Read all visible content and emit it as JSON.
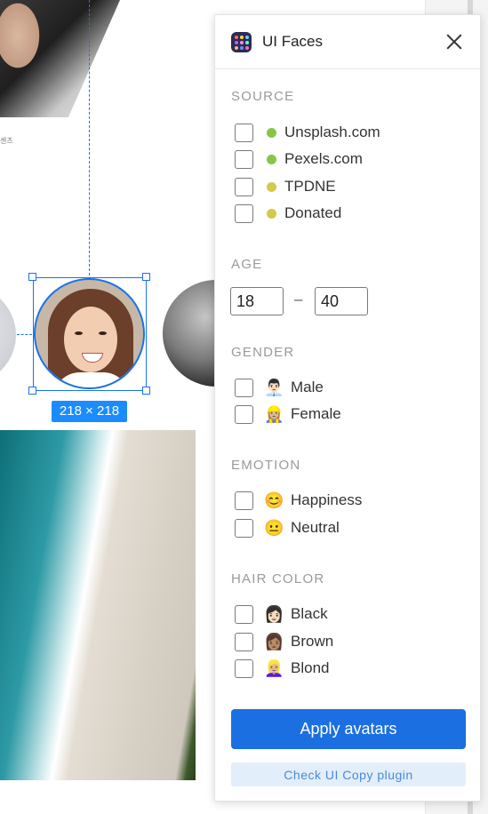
{
  "canvas": {
    "selection_size": "218 × 218",
    "tiny_text": "센츠"
  },
  "plugin": {
    "title": "UI Faces",
    "sections": {
      "source": {
        "label": "SOURCE",
        "options": [
          {
            "label": "Unsplash.com",
            "dot_color": "#8bc34a"
          },
          {
            "label": "Pexels.com",
            "dot_color": "#8bc34a"
          },
          {
            "label": "TPDNE",
            "dot_color": "#d4c94a"
          },
          {
            "label": "Donated",
            "dot_color": "#d4c94a"
          }
        ]
      },
      "age": {
        "label": "AGE",
        "min": "18",
        "max": "40",
        "separator": "–"
      },
      "gender": {
        "label": "GENDER",
        "options": [
          {
            "label": "Male",
            "emoji": "👨🏻‍💼"
          },
          {
            "label": "Female",
            "emoji": "👷🏼‍♀️"
          }
        ]
      },
      "emotion": {
        "label": "EMOTION",
        "options": [
          {
            "label": "Happiness",
            "emoji": "😊"
          },
          {
            "label": "Neutral",
            "emoji": "😐"
          }
        ]
      },
      "hair_color": {
        "label": "HAIR COLOR",
        "options": [
          {
            "label": "Black",
            "emoji": "👩🏻"
          },
          {
            "label": "Brown",
            "emoji": "👩🏽"
          },
          {
            "label": "Blond",
            "emoji": "👱🏼‍♀️"
          }
        ]
      }
    },
    "apply_button": "Apply avatars",
    "copy_button": "Check UI Copy plugin",
    "colors": {
      "accent": "#1b6fe0",
      "selection": "#1a73e8"
    }
  }
}
